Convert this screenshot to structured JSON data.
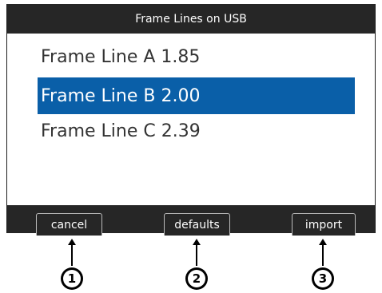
{
  "window": {
    "title": "Frame Lines on USB"
  },
  "list": {
    "items": [
      {
        "label": "Frame Line A 1.85",
        "selected": false
      },
      {
        "label": "Frame Line B 2.00",
        "selected": true
      },
      {
        "label": "Frame Line C 2.39",
        "selected": false
      }
    ]
  },
  "softkeys": {
    "cancel_label": "cancel",
    "defaults_label": "defaults",
    "import_label": "import"
  },
  "callouts": {
    "labels": [
      "1",
      "2",
      "3"
    ]
  },
  "colors": {
    "bar_background": "#262626",
    "selection": "#0a5fa8"
  },
  "icons": [
    "arrow-up-icon",
    "number-circle-icon"
  ]
}
